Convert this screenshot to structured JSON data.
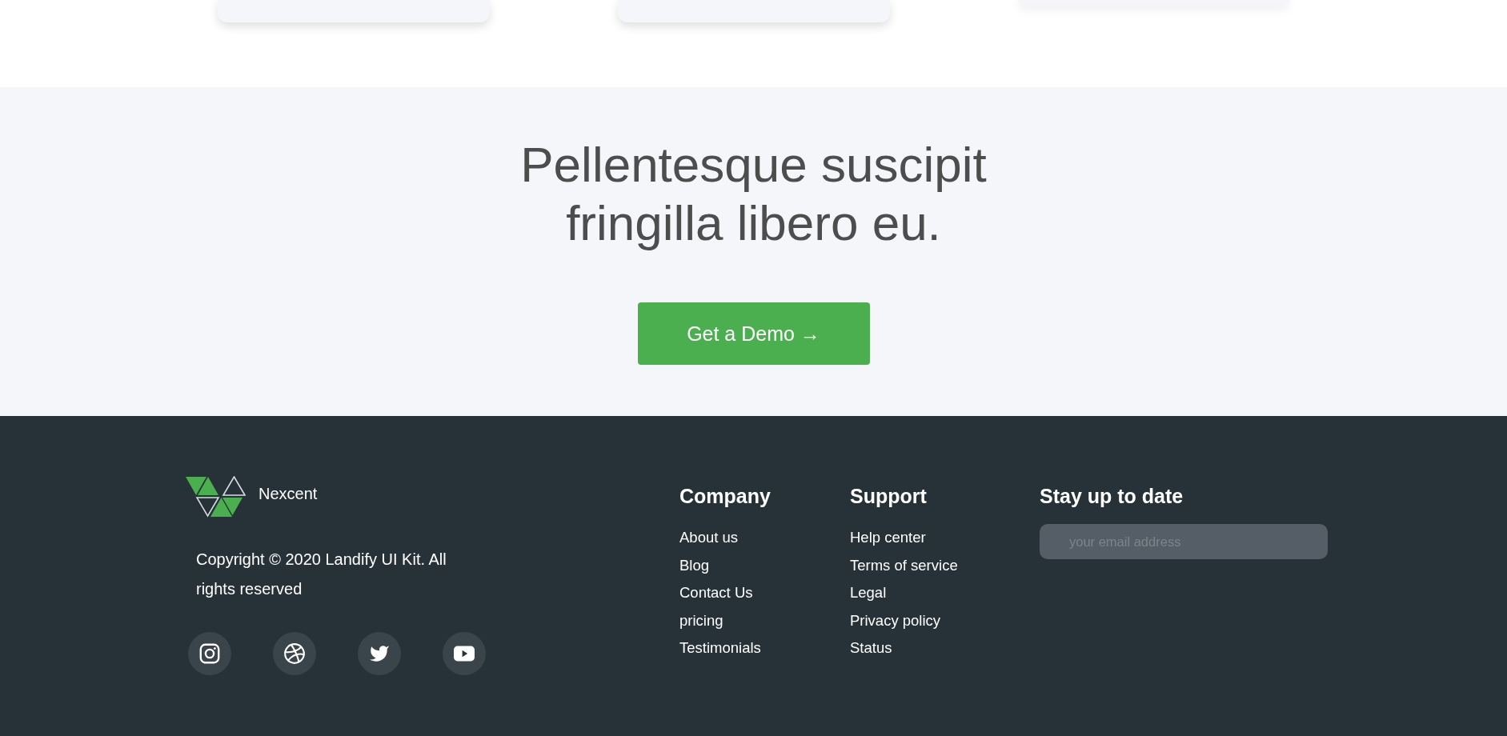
{
  "cards": [
    {
      "raised": false
    },
    {
      "raised": false
    },
    {
      "raised": true
    }
  ],
  "cta": {
    "heading": "Pellentesque suscipit fringilla libero eu.",
    "button": "Get a Demo →"
  },
  "footer": {
    "brand": {
      "name": "Nexcent",
      "copyright": "Copyright © 2020 Landify UI Kit. All rights reserved"
    },
    "social_links": [
      {
        "kind": "camera"
      },
      {
        "kind": "ball"
      },
      {
        "kind": "bird"
      },
      {
        "kind": "video"
      }
    ],
    "columns": [
      {
        "heading": "Company",
        "links": [
          "About us",
          "Blog",
          "Contact Us",
          "pricing",
          "Testimonials"
        ]
      },
      {
        "heading": "Support",
        "links": [
          "Help center",
          "Terms of service",
          "Legal",
          "Privacy policy",
          "Status"
        ]
      }
    ],
    "newsletter": {
      "heading": "Stay up to date",
      "email": {
        "placeholder": "your email address"
      }
    }
  }
}
